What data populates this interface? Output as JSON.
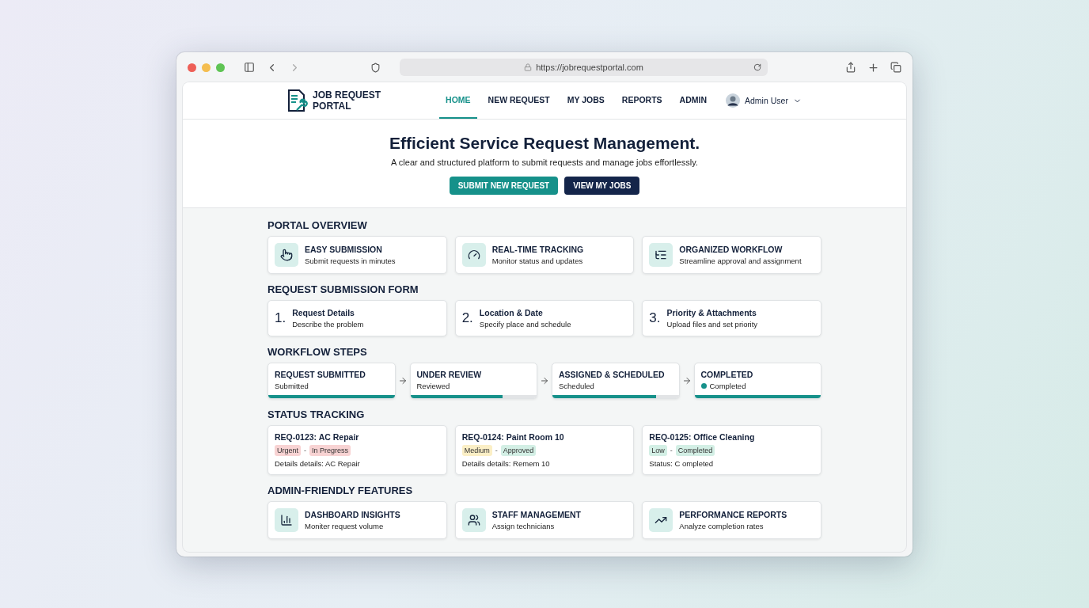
{
  "browser": {
    "url": "https://jobrequestportal.com"
  },
  "header": {
    "logo": "JOB REQUEST PORTAL",
    "nav": [
      {
        "label": "HOME",
        "selected": true
      },
      {
        "label": "NEW REQUEST",
        "selected": false
      },
      {
        "label": "MY JOBS",
        "selected": false
      },
      {
        "label": "REPORTS",
        "selected": false
      },
      {
        "label": "ADMIN",
        "selected": false
      }
    ],
    "user": "Admin User"
  },
  "hero": {
    "title": "Efficient Service Request Management.",
    "subtitle": "A clear and structured platform to submit requests and manage jobs effortlessly.",
    "buttons": [
      {
        "label": "SUBMIT NEW REQUEST",
        "kind": "primary"
      },
      {
        "label": "VIEW MY JOBS",
        "kind": "dark"
      }
    ]
  },
  "sections": [
    {
      "title": "PORTAL OVERVIEW",
      "kind": "features",
      "items": [
        {
          "title": "EASY SUBMISSION",
          "desc": "Submit requests in minutes"
        },
        {
          "title": "REAL-TIME TRACKING",
          "desc": "Monitor status and updates"
        },
        {
          "title": "ORGANIZED WORKFLOW",
          "desc": "Streamline approval and assignment"
        }
      ]
    },
    {
      "title": "REQUEST SUBMISSION FORM",
      "kind": "steps",
      "items": [
        {
          "number": "1.",
          "title": "Request Details",
          "desc": "Describe the problem"
        },
        {
          "number": "2.",
          "title": "Location & Date",
          "desc": "Specify place and schedule"
        },
        {
          "number": "3.",
          "title": "Priority & Attachments",
          "desc": "Upload files and set priority"
        }
      ]
    },
    {
      "title": "WORKFLOW STEPS",
      "kind": "workflow",
      "items": [
        {
          "title": "REQUEST SUBMITTED",
          "status": "Submitted",
          "dot": false,
          "level": 1
        },
        {
          "title": "UNDER REVIEW",
          "status": "Reviewed",
          "dot": false,
          "level": 0.73
        },
        {
          "title": "ASSIGNED & SCHEDULED",
          "status": "Scheduled",
          "dot": false,
          "level": 0.82
        },
        {
          "title": "COMPLETED",
          "status": "Completed",
          "dot": true,
          "level": 1
        }
      ]
    },
    {
      "title": "STATUS TRACKING",
      "kind": "status",
      "items": [
        {
          "title": "REQ-0123: AC Repair",
          "tags": [
            {
              "label": "Urgent",
              "color": "#f8d3d3"
            },
            {
              "label": "In Pregress",
              "color": "#f8d3d3"
            }
          ],
          "separator": "-",
          "detail": "Details details: AC Repair"
        },
        {
          "title": "REQ-0124: Paint Room 10",
          "tags": [
            {
              "label": "Medium",
              "color": "#fbefc6"
            },
            {
              "label": "Approved",
              "color": "#d3efe5"
            }
          ],
          "separator": "-",
          "detail": "Details details: Remem 10"
        },
        {
          "title": "REQ-0125: Office Cleaning",
          "tags": [
            {
              "label": "Low",
              "color": "#d3efe5"
            },
            {
              "label": "Completed",
              "color": "#d3efe5"
            }
          ],
          "separator": "-",
          "detail": "Status: C ompleted"
        }
      ]
    },
    {
      "title": "ADMIN-FRIENDLY FEATURES",
      "kind": "features",
      "items": [
        {
          "title": "DASHBOARD INSIGHTS",
          "desc": "Moniter request volume"
        },
        {
          "title": "STAFF MANAGEMENT",
          "desc": "Assign technicians"
        },
        {
          "title": "PERFORMANCE REPORTS",
          "desc": "Analyze completion rates"
        }
      ]
    }
  ]
}
